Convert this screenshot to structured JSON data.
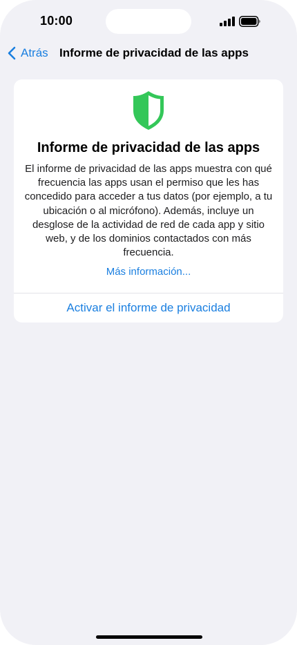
{
  "status_bar": {
    "time": "10:00"
  },
  "nav": {
    "back_label": "Atrás",
    "title": "Informe de privacidad de las apps"
  },
  "card": {
    "icon": "shield-icon",
    "icon_color": "#34c759",
    "title": "Informe de privacidad de las apps",
    "body": "El informe de privacidad de las apps muestra con qué frecuencia las apps usan el permiso que les has concedido para acceder a tus datos (por ejemplo, a tu ubicación o al micrófono). Además, incluye un desglose de la actividad de red de cada app y sitio web, y de los dominios contactados con más frecuencia.",
    "more_link": "Más información...",
    "activate_button": "Activar el informe de privacidad"
  },
  "colors": {
    "accent": "#1a7fe0",
    "background": "#f1f1f6",
    "card": "#ffffff"
  }
}
